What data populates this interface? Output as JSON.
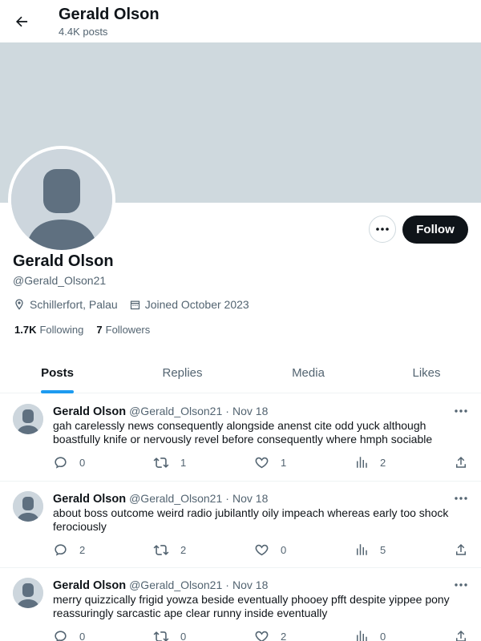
{
  "header": {
    "title": "Gerald Olson",
    "posts_count": "4.4K posts"
  },
  "profile": {
    "name": "Gerald Olson",
    "handle": "@Gerald_Olson21",
    "location": "Schillerfort, Palau",
    "joined": "Joined October 2023",
    "following_count": "1.7K",
    "following_label": "Following",
    "followers_count": "7",
    "followers_label": "Followers",
    "follow_label": "Follow"
  },
  "tabs": [
    {
      "label": "Posts",
      "active": true
    },
    {
      "label": "Replies",
      "active": false
    },
    {
      "label": "Media",
      "active": false
    },
    {
      "label": "Likes",
      "active": false
    }
  ],
  "posts": [
    {
      "author": "Gerald Olson",
      "handle": "@Gerald_Olson21",
      "separator": "·",
      "date": "Nov 18",
      "text": "gah carelessly news consequently alongside anenst cite odd yuck although boastfully knife or nervously revel before consequently where hmph sociable",
      "replies": "0",
      "reposts": "1",
      "likes": "1",
      "views": "2"
    },
    {
      "author": "Gerald Olson",
      "handle": "@Gerald_Olson21",
      "separator": "·",
      "date": "Nov 18",
      "text": "about boss outcome weird radio jubilantly oily impeach whereas early too shock ferociously",
      "replies": "2",
      "reposts": "2",
      "likes": "0",
      "views": "5"
    },
    {
      "author": "Gerald Olson",
      "handle": "@Gerald_Olson21",
      "separator": "·",
      "date": "Nov 18",
      "text": "merry quizzically frigid yowza beside eventually phooey pfft despite yippee pony reassuringly sarcastic ape clear runny inside eventually",
      "replies": "0",
      "reposts": "0",
      "likes": "2",
      "views": "0"
    }
  ],
  "icons": {
    "back": "arrow-left-icon",
    "more": "more-horizontal-icon",
    "location": "location-pin-icon",
    "calendar": "calendar-icon",
    "reply": "reply-icon",
    "repost": "repost-icon",
    "like": "heart-icon",
    "views": "views-chart-icon",
    "share": "share-icon"
  },
  "colors": {
    "accent": "#1d9bf0",
    "banner": "#cfd9de",
    "text": "#0f1419",
    "muted": "#536471",
    "follow_bg": "#0f1419"
  }
}
